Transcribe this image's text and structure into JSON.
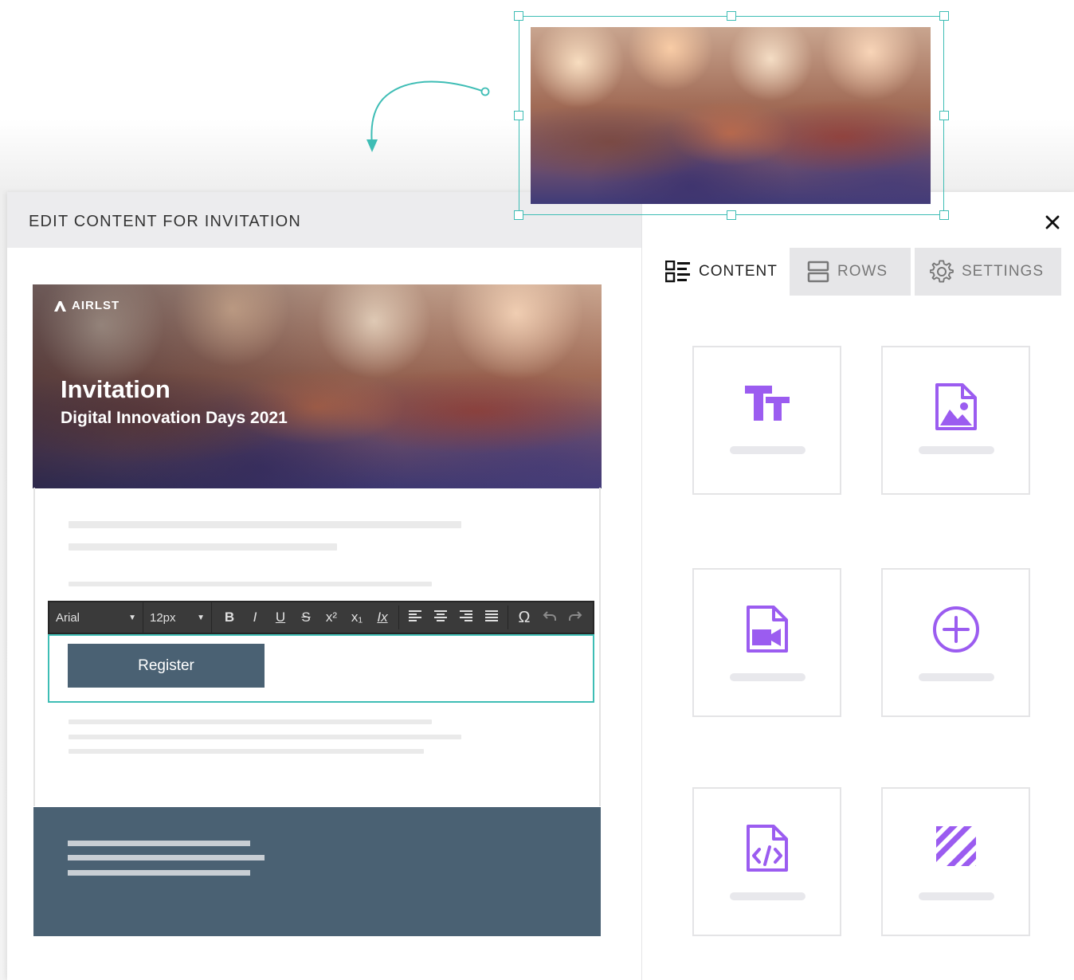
{
  "panel": {
    "title": "EDIT CONTENT FOR INVITATION",
    "close_icon": "close-icon"
  },
  "tabs": [
    {
      "label": "CONTENT",
      "icon": "content-list-icon",
      "active": true
    },
    {
      "label": "ROWS",
      "icon": "rows-icon",
      "active": false
    },
    {
      "label": "SETTINGS",
      "icon": "gear-icon",
      "active": false
    }
  ],
  "tiles": [
    {
      "icon": "text-block-icon"
    },
    {
      "icon": "image-block-icon"
    },
    {
      "icon": "video-block-icon"
    },
    {
      "icon": "add-block-icon"
    },
    {
      "icon": "html-block-icon"
    },
    {
      "icon": "divider-block-icon"
    }
  ],
  "email": {
    "logo": "AIRLST",
    "title": "Invitation",
    "subtitle": "Digital Innovation Days 2021",
    "button_label": "Register"
  },
  "toolbar": {
    "font": "Arial",
    "size": "12px",
    "buttons": [
      "B",
      "I",
      "U",
      "S",
      "x²",
      "x₁",
      "Ix",
      "align-left",
      "align-center",
      "align-right",
      "align-justify",
      "Ω",
      "undo",
      "redo"
    ]
  },
  "colors": {
    "accent": "#3ebdb5",
    "icon_purple": "#9b5cf0",
    "email_dark": "#4a6173"
  }
}
